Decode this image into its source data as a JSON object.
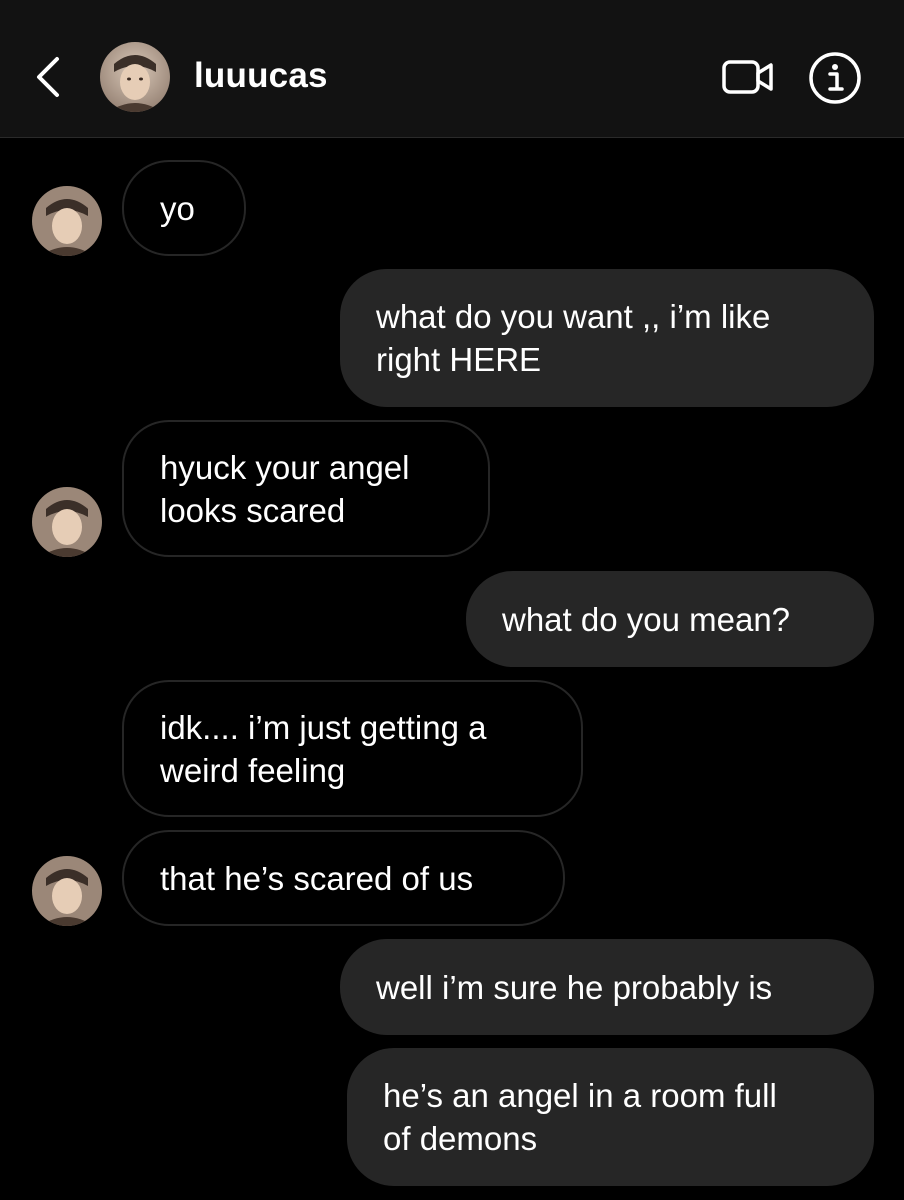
{
  "header": {
    "username": "luuucas",
    "back_icon": "chevron-left-icon",
    "video_icon": "video-camera-icon",
    "info_icon": "info-icon"
  },
  "colors": {
    "background": "#000000",
    "header_bg": "#121212",
    "outgoing_bubble": "#262626",
    "incoming_border": "#262626",
    "text": "#ffffff"
  },
  "messages": [
    {
      "direction": "incoming",
      "text": "yo"
    },
    {
      "direction": "outgoing",
      "text": "what do you want ,, i’m like\nright HERE"
    },
    {
      "direction": "incoming",
      "text": "hyuck your angel\nlooks scared"
    },
    {
      "direction": "outgoing",
      "text": "what do you mean?"
    },
    {
      "direction": "incoming",
      "text": "idk.... i’m just getting a\nweird feeling"
    },
    {
      "direction": "incoming",
      "text": "that he’s scared of us"
    },
    {
      "direction": "outgoing",
      "text": "well i’m sure he probably is"
    },
    {
      "direction": "outgoing",
      "text": "he’s an angel in a room full\nof demons"
    }
  ]
}
